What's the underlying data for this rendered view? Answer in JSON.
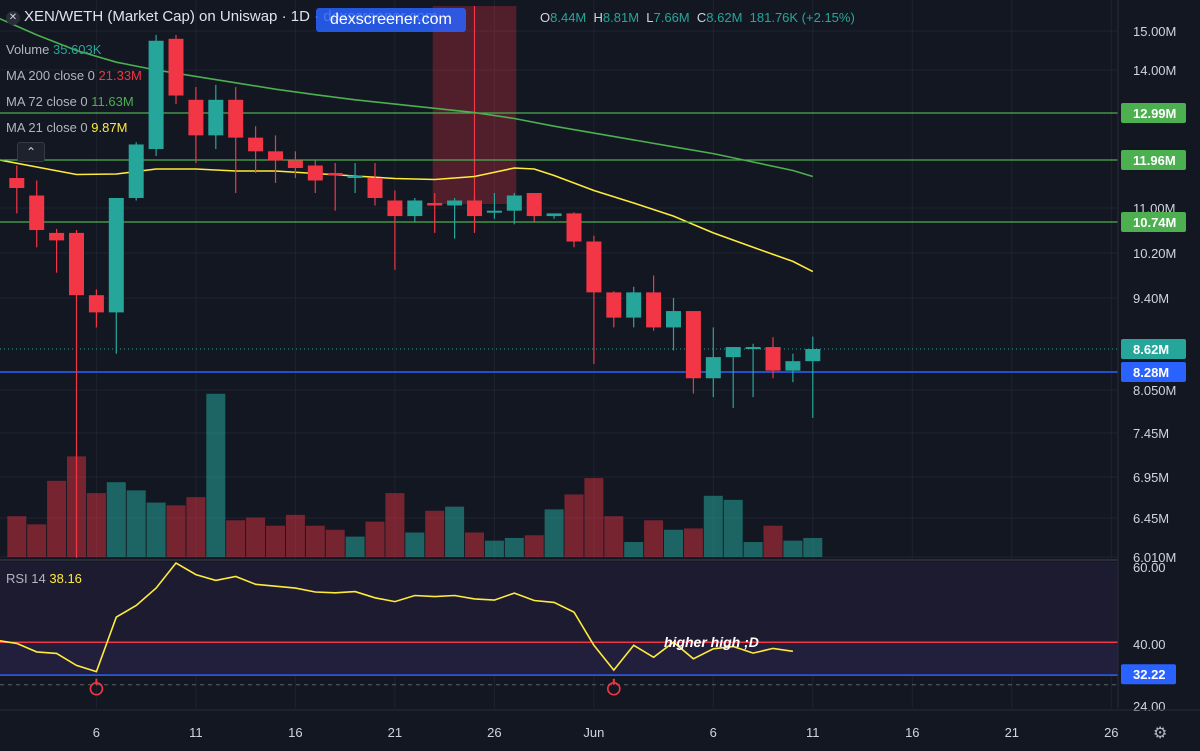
{
  "header": {
    "close_icon": "close-icon",
    "title": "XEN/WETH (Market Cap) on Uniswap · 1D · dexscreener.com",
    "watermark": "dexscreener.com",
    "ohlc": [
      {
        "k": "O",
        "v": "8.44M"
      },
      {
        "k": "H",
        "v": "8.81M"
      },
      {
        "k": "L",
        "v": "7.66M"
      },
      {
        "k": "C",
        "v": "8.62M"
      }
    ],
    "change": "181.76K (+2.15%)"
  },
  "legend": {
    "volume": {
      "label": "Volume",
      "value": "35.603K",
      "color": "#26a69a"
    },
    "ma200": {
      "label": "MA 200 close 0",
      "value": "21.33M",
      "color": "#f23645"
    },
    "ma72": {
      "label": "MA 72 close 0",
      "value": "11.63M",
      "color": "#4caf50"
    },
    "ma21": {
      "label": "MA 21 close 0",
      "value": "9.87M",
      "color": "#ffeb3b"
    },
    "collapse_icon": "chevron-up-icon",
    "rsi": {
      "label": "RSI 14",
      "value": "38.16",
      "color": "#ffeb3b"
    }
  },
  "annotation": "higher high ;D",
  "settings_icon": "gear-icon",
  "colors": {
    "up": "#26a69a",
    "down": "#f23645",
    "background": "#131722",
    "grid": "#1f2330",
    "hline_green": "#4caf50",
    "hline_blue": "#2962ff",
    "rsi_panel": "#221f3d",
    "rsi_line": "#ffeb3b"
  },
  "chart_data": {
    "type": "candlestick",
    "price_axis": {
      "ticks": [
        {
          "label": "15.00M",
          "value": 15.0
        },
        {
          "label": "14.00M",
          "value": 14.0
        },
        {
          "label": "11.00M",
          "value": 11.0
        },
        {
          "label": "10.20M",
          "value": 10.2
        },
        {
          "label": "9.40M",
          "value": 9.4
        },
        {
          "label": "8.050M",
          "value": 8.05
        },
        {
          "label": "7.45M",
          "value": 7.45
        },
        {
          "label": "6.95M",
          "value": 6.95
        },
        {
          "label": "6.45M",
          "value": 6.45
        },
        {
          "label": "6.010M",
          "value": 6.01
        }
      ],
      "price_labels": [
        {
          "label": "12.99M",
          "value": 12.99,
          "kind": "green"
        },
        {
          "label": "11.96M",
          "value": 11.96,
          "kind": "green"
        },
        {
          "label": "10.74M",
          "value": 10.74,
          "kind": "green"
        },
        {
          "label": "8.62M",
          "value": 8.62,
          "kind": "last"
        },
        {
          "label": "8.28M",
          "value": 8.28,
          "kind": "blue"
        }
      ]
    },
    "time_axis": {
      "ticks": [
        {
          "label": "6",
          "day": 6
        },
        {
          "label": "11",
          "day": 11
        },
        {
          "label": "16",
          "day": 16
        },
        {
          "label": "21",
          "day": 21
        },
        {
          "label": "26",
          "day": 26
        },
        {
          "label": "Jun",
          "day": 31
        },
        {
          "label": "6",
          "day": 37
        },
        {
          "label": "11",
          "day": 42
        },
        {
          "label": "16",
          "day": 47
        },
        {
          "label": "21",
          "day": 52
        },
        {
          "label": "26",
          "day": 57
        }
      ]
    },
    "candles": [
      {
        "day": 2,
        "o": 11.6,
        "h": 11.85,
        "l": 10.9,
        "c": 11.4,
        "vol": 0.3
      },
      {
        "day": 3,
        "o": 11.25,
        "h": 11.55,
        "l": 10.3,
        "c": 10.6,
        "vol": 0.24
      },
      {
        "day": 4,
        "o": 10.55,
        "h": 10.62,
        "l": 9.85,
        "c": 10.42,
        "vol": 0.56
      },
      {
        "day": 5,
        "o": 10.55,
        "h": 10.6,
        "l": 6.0,
        "c": 9.45,
        "vol": 0.74
      },
      {
        "day": 6,
        "o": 9.45,
        "h": 9.55,
        "l": 8.95,
        "c": 9.18,
        "vol": 0.47
      },
      {
        "day": 7,
        "o": 9.18,
        "h": 11.1,
        "l": 8.55,
        "c": 11.2,
        "vol": 0.55
      },
      {
        "day": 8,
        "o": 11.2,
        "h": 12.35,
        "l": 11.15,
        "c": 12.3,
        "vol": 0.49
      },
      {
        "day": 9,
        "o": 12.2,
        "h": 14.9,
        "l": 12.05,
        "c": 14.75,
        "vol": 0.4
      },
      {
        "day": 10,
        "o": 14.8,
        "h": 14.9,
        "l": 13.2,
        "c": 13.4,
        "vol": 0.38
      },
      {
        "day": 11,
        "o": 13.3,
        "h": 13.6,
        "l": 11.9,
        "c": 12.5,
        "vol": 0.44
      },
      {
        "day": 12,
        "o": 12.5,
        "h": 13.65,
        "l": 12.2,
        "c": 13.3,
        "vol": 1.2
      },
      {
        "day": 13,
        "o": 13.3,
        "h": 13.6,
        "l": 11.3,
        "c": 12.45,
        "vol": 0.27
      },
      {
        "day": 14,
        "o": 12.45,
        "h": 12.7,
        "l": 11.7,
        "c": 12.15,
        "vol": 0.29
      },
      {
        "day": 15,
        "o": 12.15,
        "h": 12.5,
        "l": 11.5,
        "c": 11.95,
        "vol": 0.23
      },
      {
        "day": 16,
        "o": 11.95,
        "h": 12.15,
        "l": 11.6,
        "c": 11.8,
        "vol": 0.31
      },
      {
        "day": 17,
        "o": 11.85,
        "h": 11.95,
        "l": 11.3,
        "c": 11.55,
        "vol": 0.23
      },
      {
        "day": 18,
        "o": 11.7,
        "h": 11.9,
        "l": 10.95,
        "c": 11.65,
        "vol": 0.2
      },
      {
        "day": 19,
        "o": 11.6,
        "h": 11.9,
        "l": 11.3,
        "c": 11.65,
        "vol": 0.15
      },
      {
        "day": 20,
        "o": 11.6,
        "h": 11.9,
        "l": 11.05,
        "c": 11.2,
        "vol": 0.26
      },
      {
        "day": 21,
        "o": 11.15,
        "h": 11.35,
        "l": 9.9,
        "c": 10.85,
        "vol": 0.47
      },
      {
        "day": 22,
        "o": 10.85,
        "h": 11.2,
        "l": 10.75,
        "c": 11.15,
        "vol": 0.18
      },
      {
        "day": 23,
        "o": 11.1,
        "h": 11.3,
        "l": 10.55,
        "c": 11.05,
        "vol": 0.34
      },
      {
        "day": 24,
        "o": 11.05,
        "h": 11.2,
        "l": 10.45,
        "c": 11.15,
        "vol": 0.37
      },
      {
        "day": 25,
        "o": 11.15,
        "h": 11.25,
        "l": 10.55,
        "c": 10.85,
        "vol": 0.18
      },
      {
        "day": 26,
        "o": 10.95,
        "h": 11.3,
        "l": 10.8,
        "c": 10.95,
        "vol": 0.12
      },
      {
        "day": 27,
        "o": 10.95,
        "h": 11.3,
        "l": 10.7,
        "c": 11.25,
        "vol": 0.14
      },
      {
        "day": 28,
        "o": 11.3,
        "h": 11.3,
        "l": 10.75,
        "c": 10.85,
        "vol": 0.16
      },
      {
        "day": 29,
        "o": 10.85,
        "h": 10.9,
        "l": 10.8,
        "c": 10.9,
        "vol": 0.35
      },
      {
        "day": 30,
        "o": 10.9,
        "h": 10.92,
        "l": 10.3,
        "c": 10.4,
        "vol": 0.46
      },
      {
        "day": 31,
        "o": 10.4,
        "h": 10.5,
        "l": 8.4,
        "c": 9.5,
        "vol": 0.58
      },
      {
        "day": 32,
        "o": 9.5,
        "h": 9.52,
        "l": 8.95,
        "c": 9.1,
        "vol": 0.3
      },
      {
        "day": 33,
        "o": 9.1,
        "h": 9.6,
        "l": 8.95,
        "c": 9.5,
        "vol": 0.11
      },
      {
        "day": 34,
        "o": 9.5,
        "h": 9.8,
        "l": 8.9,
        "c": 8.95,
        "vol": 0.27
      },
      {
        "day": 35,
        "o": 8.95,
        "h": 9.4,
        "l": 8.6,
        "c": 9.2,
        "vol": 0.2
      },
      {
        "day": 36,
        "o": 9.2,
        "h": 9.2,
        "l": 8.0,
        "c": 8.2,
        "vol": 0.21
      },
      {
        "day": 37,
        "o": 8.2,
        "h": 8.95,
        "l": 7.95,
        "c": 8.5,
        "vol": 0.45
      },
      {
        "day": 38,
        "o": 8.5,
        "h": 8.6,
        "l": 7.8,
        "c": 8.65,
        "vol": 0.42
      },
      {
        "day": 39,
        "o": 8.65,
        "h": 8.7,
        "l": 7.95,
        "c": 8.65,
        "vol": 0.11
      },
      {
        "day": 40,
        "o": 8.65,
        "h": 8.8,
        "l": 8.2,
        "c": 8.3,
        "vol": 0.23
      },
      {
        "day": 41,
        "o": 8.3,
        "h": 8.55,
        "l": 8.15,
        "c": 8.44,
        "vol": 0.12
      },
      {
        "day": 42,
        "o": 8.44,
        "h": 8.81,
        "l": 7.66,
        "c": 8.62,
        "vol": 0.14
      }
    ],
    "ma21": [
      [
        1,
        11.97
      ],
      [
        3,
        11.82
      ],
      [
        5,
        11.67
      ],
      [
        7,
        11.68
      ],
      [
        9,
        11.78
      ],
      [
        11,
        11.78
      ],
      [
        13,
        11.74
      ],
      [
        15,
        11.74
      ],
      [
        17,
        11.69
      ],
      [
        19,
        11.64
      ],
      [
        21,
        11.59
      ],
      [
        23,
        11.57
      ],
      [
        25,
        11.63
      ],
      [
        27,
        11.8
      ],
      [
        28,
        11.78
      ],
      [
        29,
        11.65
      ],
      [
        31,
        11.35
      ],
      [
        33,
        11.1
      ],
      [
        35,
        10.85
      ],
      [
        37,
        10.55
      ],
      [
        39,
        10.3
      ],
      [
        41,
        10.05
      ],
      [
        42,
        9.87
      ]
    ],
    "ma72": [
      [
        1,
        15.35
      ],
      [
        3,
        14.9
      ],
      [
        5,
        14.5
      ],
      [
        7,
        14.2
      ],
      [
        9,
        14.0
      ],
      [
        11,
        13.85
      ],
      [
        13,
        13.7
      ],
      [
        15,
        13.55
      ],
      [
        17,
        13.42
      ],
      [
        19,
        13.3
      ],
      [
        21,
        13.2
      ],
      [
        23,
        13.1
      ],
      [
        25,
        13.0
      ],
      [
        27,
        12.87
      ],
      [
        29,
        12.7
      ],
      [
        31,
        12.55
      ],
      [
        33,
        12.4
      ],
      [
        35,
        12.25
      ],
      [
        37,
        12.1
      ],
      [
        39,
        11.92
      ],
      [
        41,
        11.75
      ],
      [
        42,
        11.63
      ]
    ],
    "rsi": {
      "label": "RSI 14",
      "axis_ticks": [
        {
          "label": "60.00",
          "value": 60
        },
        {
          "label": "40.00",
          "value": 40
        },
        {
          "label": "24.00",
          "value": 24
        }
      ],
      "last_label": "32.22",
      "last_label_value": 32.22,
      "upper_line": 40.5,
      "lower_line": 32.0,
      "dashed_line": 29.5,
      "values": [
        [
          1,
          41.0
        ],
        [
          2,
          40.2
        ],
        [
          3,
          38.0
        ],
        [
          4,
          37.6
        ],
        [
          5,
          34.5
        ],
        [
          6,
          32.9
        ],
        [
          7,
          47.0
        ],
        [
          8,
          50.0
        ],
        [
          9,
          54.5
        ],
        [
          10,
          61.0
        ],
        [
          11,
          58.0
        ],
        [
          12,
          56.5
        ],
        [
          13,
          57.5
        ],
        [
          14,
          55.5
        ],
        [
          15,
          55.0
        ],
        [
          16,
          54.5
        ],
        [
          17,
          53.5
        ],
        [
          18,
          53.3
        ],
        [
          19,
          53.6
        ],
        [
          20,
          52.0
        ],
        [
          21,
          51.0
        ],
        [
          22,
          52.6
        ],
        [
          23,
          52.3
        ],
        [
          24,
          52.6
        ],
        [
          25,
          51.7
        ],
        [
          26,
          51.4
        ],
        [
          27,
          53.2
        ],
        [
          28,
          51.3
        ],
        [
          29,
          50.8
        ],
        [
          30,
          48.3
        ],
        [
          31,
          39.7
        ],
        [
          32,
          33.3
        ],
        [
          33,
          39.7
        ],
        [
          34,
          36.6
        ],
        [
          35,
          40.5
        ],
        [
          36,
          36.2
        ],
        [
          37,
          38.8
        ],
        [
          38,
          39.4
        ],
        [
          39,
          37.7
        ],
        [
          40,
          38.9
        ],
        [
          41,
          38.16
        ]
      ],
      "markers": [
        6,
        32
      ]
    },
    "hlines": [
      12.99,
      11.96,
      10.74
    ],
    "blue_line": 8.28,
    "last_price": 8.62,
    "highlight": {
      "from_day": 23,
      "to_day": 27
    },
    "crosshair_day": 25
  }
}
